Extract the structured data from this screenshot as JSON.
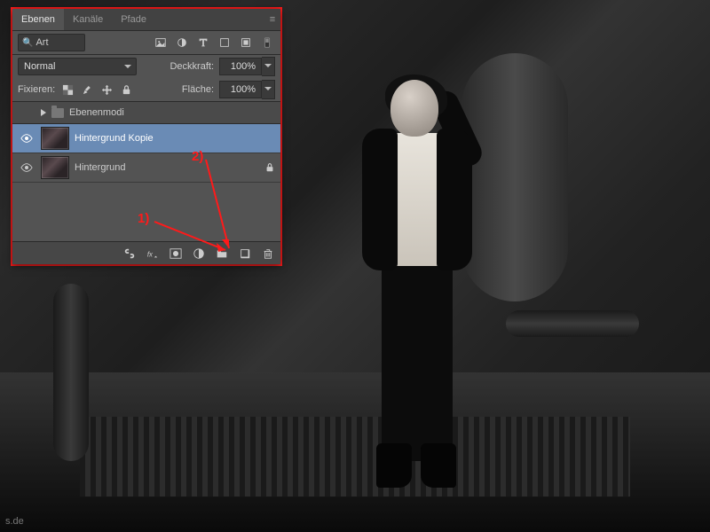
{
  "panel": {
    "tabs": [
      "Ebenen",
      "Kanäle",
      "Pfade"
    ],
    "active_tab": 0,
    "search_placeholder": "Art",
    "blend_mode": "Normal",
    "opacity_label": "Deckkraft:",
    "opacity_value": "100%",
    "lock_label": "Fixieren:",
    "fill_label": "Fläche:",
    "fill_value": "100%",
    "group_name": "Ebenenmodi",
    "layers": [
      {
        "name": "Hintergrund Kopie",
        "visible": true,
        "selected": true,
        "locked": false
      },
      {
        "name": "Hintergrund",
        "visible": true,
        "selected": false,
        "locked": true
      }
    ]
  },
  "annotations": {
    "n1": "1)",
    "n2": "2)"
  },
  "watermark": "s.de"
}
